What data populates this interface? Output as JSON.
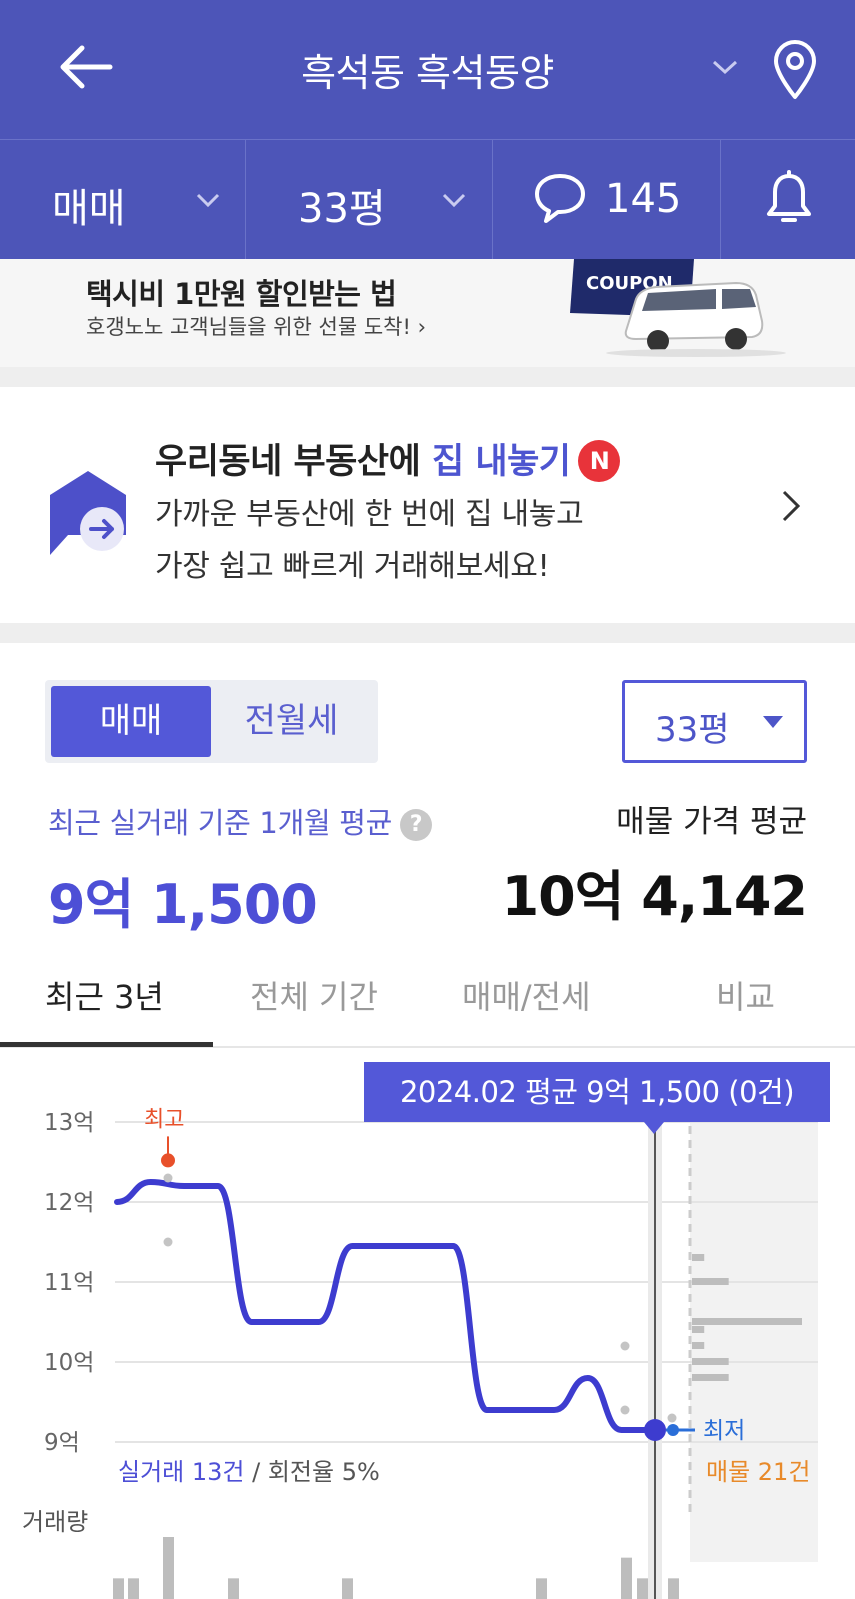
{
  "header": {
    "title": "흑석동 흑석동양",
    "back_icon": "arrow-left-icon",
    "location_icon": "map-pin-icon"
  },
  "subbar": {
    "trade_type": "매매",
    "size": "33평",
    "comment_count": "145",
    "comment_icon": "speech-bubble-icon",
    "bell_icon": "bell-icon"
  },
  "promo": {
    "title": "택시비 1만원 할인받는 법",
    "subtitle": "호갱노노 고객님들을 위한 선물 도착! ›",
    "coupon_label": "COUPON"
  },
  "listing": {
    "title_prefix": "우리동네 부동산에 ",
    "title_accent": "집 내놓기",
    "badge": "N",
    "line1": "가까운 부동산에 한 번에 집 내놓고",
    "line2": "가장 쉽고 빠르게 거래해보세요!"
  },
  "price": {
    "seg_active": "매매",
    "seg_inactive": "전월세",
    "size_select": "33평",
    "recent_label": "최근 실거래 기준 1개월 평균",
    "help": "?",
    "recent_price": "9억 1,500",
    "avg_label": "매물 가격 평균",
    "avg_price": "10억 4,142"
  },
  "tabs": [
    "최근 3년",
    "전체 기간",
    "매매/전세",
    "비교"
  ],
  "colors": {
    "primary": "#4d55b8",
    "accent": "#5358d8",
    "line": "#3d3ccf",
    "high": "#e8502a",
    "low": "#2a6ed8",
    "listing_count": "#e88a2a"
  },
  "chart_data": {
    "type": "line",
    "y_axis_labels": [
      "13억",
      "12억",
      "11억",
      "10억",
      "9억"
    ],
    "ylim": [
      9,
      13
    ],
    "y_unit": "억",
    "tooltip": "2024.02 평균 9억 1,500 (0건)",
    "high_label": "최고",
    "low_label": "최저",
    "trade_count_label": "실거래 13건",
    "turnover_label": " / 회전율 5%",
    "listing_count_label": "매물 21건",
    "volume_label": "거래량",
    "series": [
      {
        "values": [
          12.0,
          12.25,
          12.2,
          12.2,
          10.5,
          10.5,
          10.5,
          11.45,
          11.45,
          11.45,
          11.45,
          9.4,
          9.4,
          9.4,
          9.8,
          9.15,
          9.15
        ]
      }
    ],
    "trade_points": [
      12.3,
      11.5,
      10.2,
      9.4,
      9.3
    ],
    "listing_bars": [
      {
        "price": 11.3,
        "count": 1
      },
      {
        "price": 11.0,
        "count": 3
      },
      {
        "price": 10.5,
        "count": 9
      },
      {
        "price": 10.4,
        "count": 1
      },
      {
        "price": 10.2,
        "count": 1
      },
      {
        "price": 10.0,
        "count": 3
      },
      {
        "price": 9.8,
        "count": 3
      }
    ],
    "volume": [
      1,
      1,
      3,
      1,
      1,
      1,
      2,
      1,
      1
    ]
  }
}
